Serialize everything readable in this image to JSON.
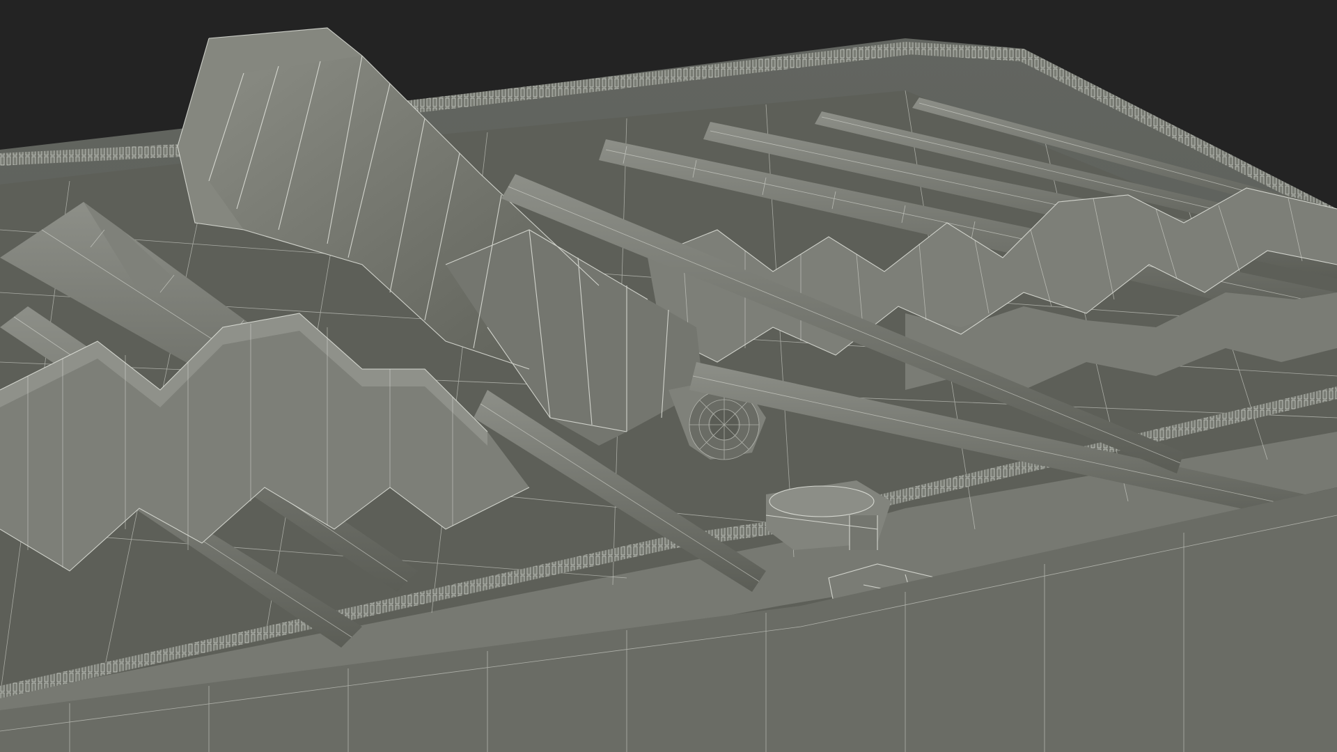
{
  "scene": {
    "description_visible_text": "",
    "colors": {
      "background": "#232323",
      "mesh_fill": "#6f716a",
      "mesh_fill_dark": "#55574f",
      "mesh_fill_light": "#858880",
      "wireframe": "#e9ebe4"
    },
    "objects": [
      "zippered-tool-case",
      "screwdriver-handle",
      "screwdriver-shafts",
      "elastic-tool-straps",
      "zipper-teeth",
      "zipper-slider",
      "zipper-pull-tab"
    ]
  }
}
